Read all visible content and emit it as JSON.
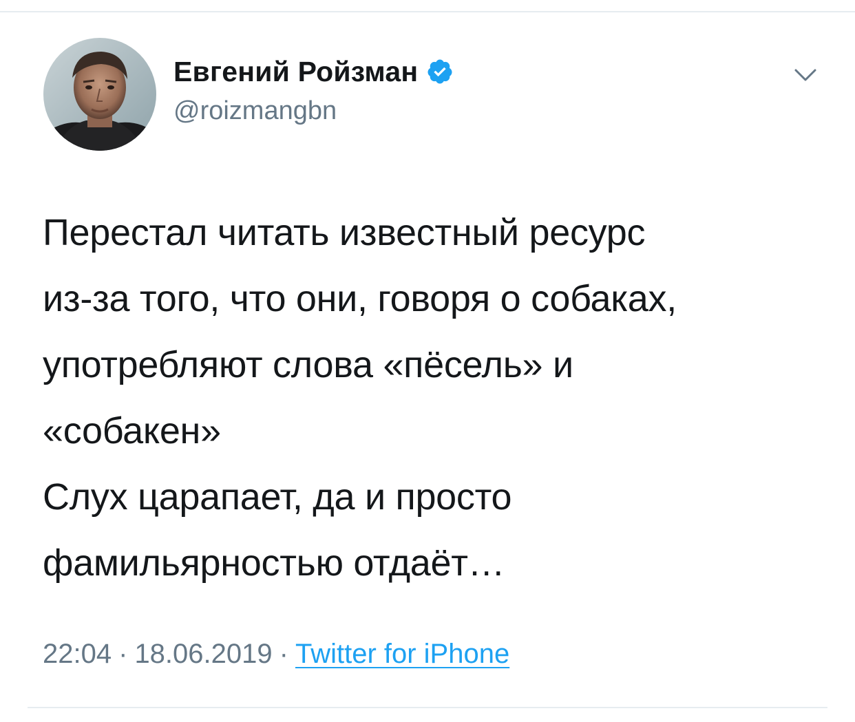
{
  "tweet": {
    "author": {
      "display_name": "Евгений Ройзман",
      "handle": "@roizmangbn",
      "verified": true
    },
    "text": "Перестал читать известный ресурс\nиз-за того, что они, говоря о собаках,\nупотребляют слова «пёсель» и\n«собакен»\nСлух царапает, да и просто\nфамильярностью отдаёт…",
    "time": "22:04",
    "date": "18.06.2019",
    "separator": "·",
    "source": "Twitter for iPhone"
  },
  "icons": {
    "verified": "verified-badge-icon",
    "more": "chevron-down-icon"
  },
  "colors": {
    "text_primary": "#14171a",
    "text_secondary": "#657786",
    "accent": "#1da1f2",
    "divider": "#e6ecf0"
  }
}
